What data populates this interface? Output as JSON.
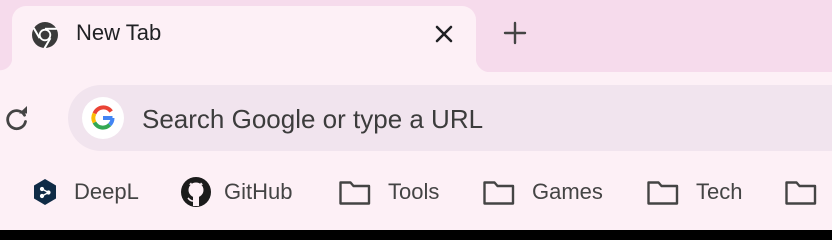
{
  "tab": {
    "title": "New Tab",
    "favicon_icon": "chrome-logo-icon",
    "close_icon": "close-icon"
  },
  "tabstrip": {
    "new_tab_icon": "plus-icon"
  },
  "toolbar": {
    "reload_icon": "reload-icon"
  },
  "omnibox": {
    "placeholder": "Search Google or type a URL",
    "icon": "google-g-icon"
  },
  "bookmarks": [
    {
      "label": "DeepL",
      "icon": "deepl-logo-icon"
    },
    {
      "label": "GitHub",
      "icon": "github-logo-icon"
    },
    {
      "label": "Tools",
      "icon": "folder-icon"
    },
    {
      "label": "Games",
      "icon": "folder-icon"
    },
    {
      "label": "Tech",
      "icon": "folder-icon"
    },
    {
      "label": "",
      "icon": "folder-icon"
    }
  ],
  "colors": {
    "tabstrip_background": "#f6dbec",
    "active_tab_background": "#fdf0f6",
    "omnibox_background": "#f1e4ee"
  }
}
